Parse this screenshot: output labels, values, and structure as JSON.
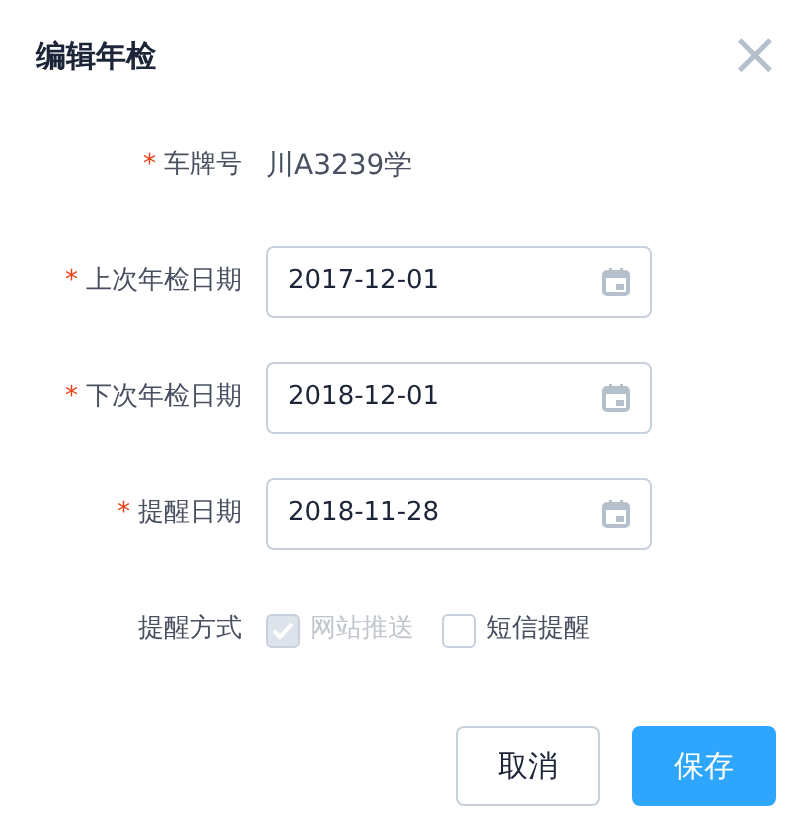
{
  "dialog": {
    "title": "编辑年检",
    "close": "×"
  },
  "fields": [
    {
      "kind": "text",
      "label": "车牌号",
      "required_mark": "*",
      "value": "川A3239学"
    },
    {
      "kind": "date",
      "label": "上次年检日期",
      "required_mark": "*",
      "value": "2017-12-01"
    },
    {
      "kind": "date",
      "label": "下次年检日期",
      "required_mark": "*",
      "value": "2018-12-01"
    },
    {
      "kind": "date",
      "label": "提醒日期",
      "required_mark": "*",
      "value": "2018-11-28"
    },
    {
      "kind": "checks",
      "label": "提醒方式",
      "options": [
        {
          "label": "网站推送",
          "checked": true,
          "disabled": true
        },
        {
          "label": "短信提醒",
          "checked": false,
          "disabled": false
        }
      ]
    }
  ],
  "buttons": [
    {
      "label": "取消",
      "primary": false
    },
    {
      "label": "保存",
      "primary": true
    }
  ]
}
